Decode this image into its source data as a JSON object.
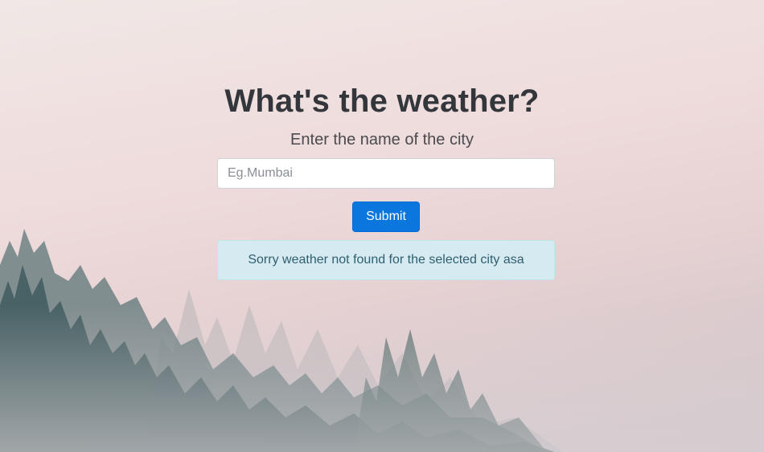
{
  "page": {
    "title": "What's the weather?",
    "subtitle": "Enter the name of the city"
  },
  "form": {
    "city_input": {
      "value": "",
      "placeholder": "Eg.Mumbai"
    },
    "submit_label": "Submit"
  },
  "alert": {
    "message": "Sorry weather not found for the selected city asa"
  },
  "colors": {
    "accent": "#0b76de",
    "title_text": "#33363b",
    "alert_bg": "#d6eaf2",
    "alert_text": "#2f5f6e"
  },
  "background": {
    "icon": "misty-forest-background"
  }
}
